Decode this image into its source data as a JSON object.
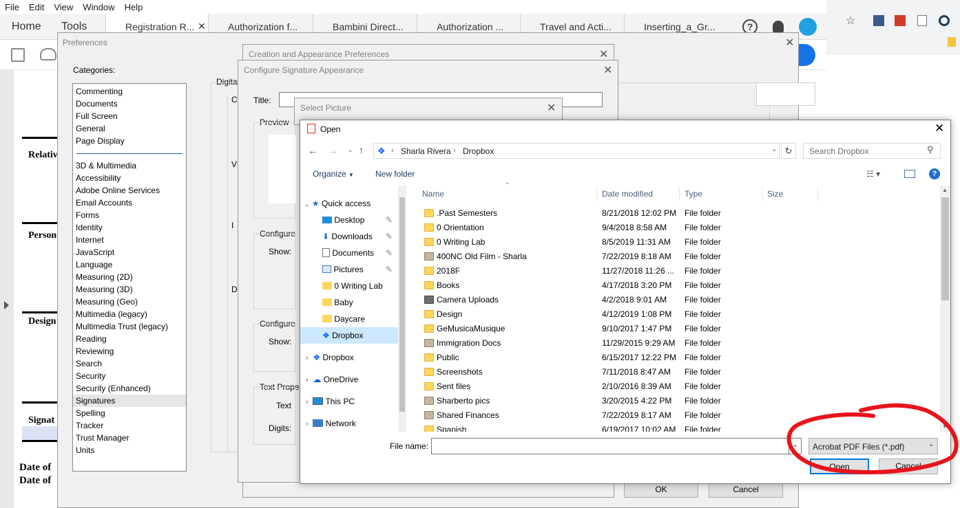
{
  "acrobat": {
    "menu": [
      "File",
      "Edit",
      "View",
      "Window",
      "Help"
    ],
    "home": "Home",
    "tools": "Tools",
    "tabs": [
      "Registration R...",
      "Authorization f...",
      "Bambini Direct...",
      "Authorization ...",
      "Travel and Acti...",
      "Inserting_a_Gr..."
    ],
    "doc_labels": [
      "Relativ",
      "Person",
      "Design",
      "Signat",
      "Date of",
      "Date of"
    ]
  },
  "preferences": {
    "title": "Preferences",
    "categories_label": "Categories:",
    "top_categories": [
      "Commenting",
      "Documents",
      "Full Screen",
      "General",
      "Page Display"
    ],
    "categories": [
      "3D & Multimedia",
      "Accessibility",
      "Adobe Online Services",
      "Email Accounts",
      "Forms",
      "Identity",
      "Internet",
      "JavaScript",
      "Language",
      "Measuring (2D)",
      "Measuring (3D)",
      "Measuring (Geo)",
      "Multimedia (legacy)",
      "Multimedia Trust (legacy)",
      "Reading",
      "Reviewing",
      "Search",
      "Security",
      "Security (Enhanced)",
      "Signatures",
      "Spelling",
      "Tracker",
      "Trust Manager",
      "Units"
    ],
    "selected_category": "Signatures",
    "digital_label": "Digita",
    "ok": "OK",
    "cancel": "Cancel"
  },
  "creation_dialog": {
    "title": "Creation and Appearance Preferences"
  },
  "configure_dialog": {
    "title": "Configure Signature Appearance",
    "title_label": "Title:",
    "preview_label": "Preview",
    "configure1": "Configure",
    "show1": "Show:",
    "configure2": "Configure",
    "show2": "Show:",
    "text_props": "Text Prope",
    "text_label": "Text",
    "digits_label": "Digits:"
  },
  "select_picture": {
    "title": "Select Picture"
  },
  "open_dialog": {
    "title": "Open",
    "breadcrumb": [
      "Sharla Rivera",
      "Dropbox"
    ],
    "search_placeholder": "Search Dropbox",
    "organize": "Organize",
    "new_folder": "New folder",
    "columns": {
      "name": "Name",
      "date": "Date modified",
      "type": "Type",
      "size": "Size"
    },
    "nav": {
      "quick_access": "Quick access",
      "quick_items": [
        "Desktop",
        "Downloads",
        "Documents",
        "Pictures",
        "0 Writing Lab",
        "Baby",
        "Daycare",
        "Dropbox"
      ],
      "roots": [
        "Dropbox",
        "OneDrive",
        "This PC",
        "Network"
      ]
    },
    "files": [
      {
        "name": ".Past Semesters",
        "date": "8/21/2018 12:02 PM",
        "type": "File folder"
      },
      {
        "name": "0 Orientation",
        "date": "9/4/2018 8:58 AM",
        "type": "File folder"
      },
      {
        "name": "0 Writing Lab",
        "date": "8/5/2019 11:31 AM",
        "type": "File folder"
      },
      {
        "name": "400NC Old Film - Sharla",
        "date": "7/22/2019 8:18 AM",
        "type": "File folder"
      },
      {
        "name": "2018F",
        "date": "11/27/2018 11:26 ...",
        "type": "File folder"
      },
      {
        "name": "Books",
        "date": "4/17/2018 3:20 PM",
        "type": "File folder"
      },
      {
        "name": "Camera Uploads",
        "date": "4/2/2018 9:01 AM",
        "type": "File folder"
      },
      {
        "name": "Design",
        "date": "4/12/2019 1:08 PM",
        "type": "File folder"
      },
      {
        "name": "GeMusicaMusique",
        "date": "9/10/2017 1:47 PM",
        "type": "File folder"
      },
      {
        "name": "Immigration Docs",
        "date": "11/29/2015 9:29 AM",
        "type": "File folder"
      },
      {
        "name": "Public",
        "date": "6/15/2017 12:22 PM",
        "type": "File folder"
      },
      {
        "name": "Screenshots",
        "date": "7/11/2018 8:47 AM",
        "type": "File folder"
      },
      {
        "name": "Sent files",
        "date": "2/10/2016 8:39 AM",
        "type": "File folder"
      },
      {
        "name": "Sharberto pics",
        "date": "3/20/2015 4:22 PM",
        "type": "File folder"
      },
      {
        "name": "Shared Finances",
        "date": "7/22/2019 8:17 AM",
        "type": "File folder"
      },
      {
        "name": "Spanish",
        "date": "6/19/2017 10:02 AM",
        "type": "File folder"
      }
    ],
    "filename_label": "File name:",
    "filename_value": "",
    "filter": "Acrobat PDF Files (*.pdf)",
    "open_button": "Open",
    "cancel_button": "Cancel"
  },
  "colors": {
    "accent": "#0078d7",
    "annotation": "#e8141b",
    "selection": "#cce8ff"
  }
}
